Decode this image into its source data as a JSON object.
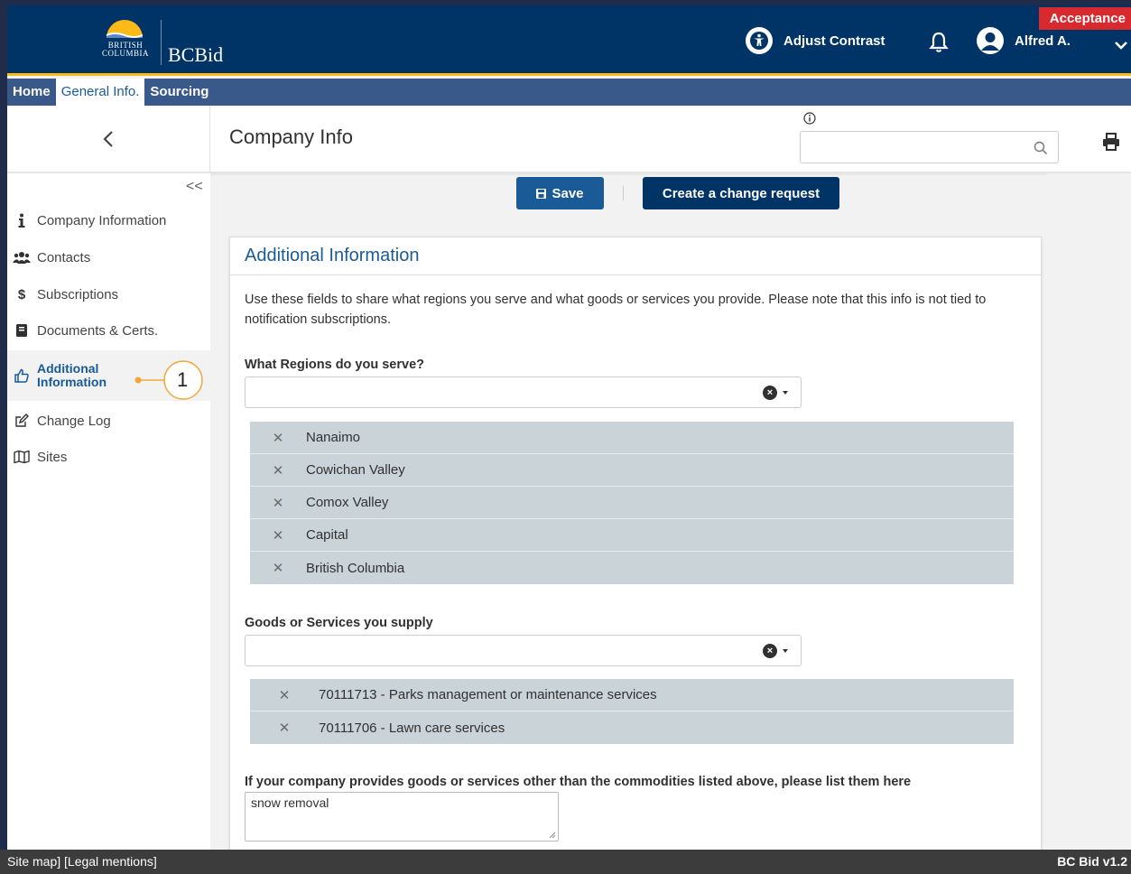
{
  "header": {
    "logo_line1": "BRITISH",
    "logo_line2": "COLUMBIA",
    "app_name": "BCBid",
    "adjust_contrast": "Adjust Contrast",
    "user_name": "Alfred A.",
    "environment_badge": "Acceptance"
  },
  "nav": {
    "items": [
      {
        "label": "Home"
      },
      {
        "label": "General Info."
      },
      {
        "label": "Sourcing"
      }
    ],
    "active": "General Info."
  },
  "subheader": {
    "title": "Company Info",
    "search_value": ""
  },
  "sidebar": {
    "collapse": "<<",
    "items": [
      {
        "label": "Company Information",
        "icon": "info-icon"
      },
      {
        "label": "Contacts",
        "icon": "users-icon"
      },
      {
        "label": "Subscriptions",
        "icon": "dollar-icon"
      },
      {
        "label": "Documents & Certs.",
        "icon": "book-icon"
      },
      {
        "label": "Additional",
        "label2": "Information",
        "icon": "thumbs-up-icon"
      },
      {
        "label": "Change Log",
        "icon": "edit-icon"
      },
      {
        "label": "Sites",
        "icon": "map-icon"
      }
    ],
    "active_index": 4,
    "callout_number": "1"
  },
  "toolbar": {
    "save_label": "Save",
    "change_request_label": "Create a change request"
  },
  "panel": {
    "title": "Additional Information",
    "description": "Use these fields to share what regions you serve and what goods or services you provide. Please note that this info is not tied to notification subscriptions.",
    "regions": {
      "label": "What Regions do you serve?",
      "items": [
        "Nanaimo",
        "Cowichan Valley",
        "Comox Valley",
        "Capital",
        "British Columbia"
      ]
    },
    "goods": {
      "label": "Goods or Services you supply",
      "items": [
        "70111713 - Parks management or maintenance services",
        "70111706 - Lawn care services"
      ]
    },
    "other": {
      "label": "If your company provides goods or services other than the commodities listed above, please list them here",
      "value": "snow removal"
    }
  },
  "footer": {
    "links": "Site map] [Legal mentions]",
    "version": "BC Bid v1.2"
  },
  "colors": {
    "header_bg": "#003366",
    "nav_bg": "#38598a",
    "accent_gold": "#fcba19",
    "primary_button": "#1a5a96",
    "tag_bg": "#c9d3d8",
    "badge_red": "#d8292f"
  }
}
